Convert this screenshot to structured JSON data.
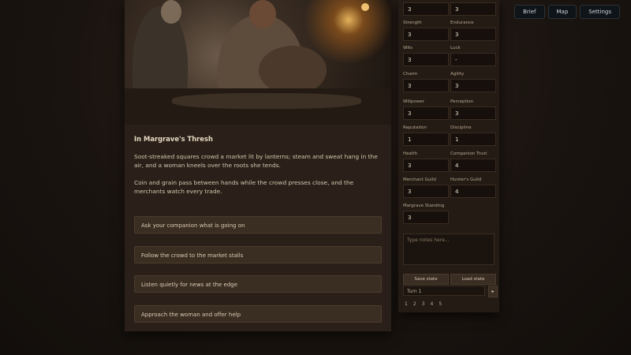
{
  "top_buttons": [
    "Brief",
    "Map",
    "Settings"
  ],
  "story": {
    "title": "In Margrave's Thresh",
    "paragraphs": [
      "Soot-streaked squares crowd a market lit by lanterns; steam and sweat hang in the air, and a woman kneels over the roots she tends.",
      "Coin and grain pass between hands while the crowd presses close, and the merchants watch every trade."
    ]
  },
  "choices": [
    "Ask your companion what is going on",
    "Follow the crowd to the market stalls",
    "Listen quietly for news at the edge",
    "Approach the woman and offer help"
  ],
  "stats": [
    {
      "label": "",
      "value": "3"
    },
    {
      "label": "",
      "value": "3"
    },
    {
      "label": "Strength",
      "value": "3"
    },
    {
      "label": "Endurance",
      "value": "3"
    },
    {
      "label": "Wits",
      "value": "3"
    },
    {
      "label": "Luck",
      "value": "-"
    },
    {
      "label": "Charm",
      "value": "3"
    },
    {
      "label": "Agility",
      "value": "3"
    },
    {
      "label": "Willpower",
      "value": "3"
    },
    {
      "label": "Perception",
      "value": "3"
    },
    {
      "label": "Reputation",
      "value": "1"
    },
    {
      "label": "Discipline",
      "value": "1"
    },
    {
      "label": "Health",
      "value": "3"
    },
    {
      "label": "Companion Trust",
      "value": "4"
    },
    {
      "label": "Merchant Guild",
      "value": "3"
    },
    {
      "label": "Hunter's Guild",
      "value": "4"
    },
    {
      "label": "Margrave Standing",
      "value": "3"
    }
  ],
  "notes_placeholder": "Type notes here...",
  "actions": {
    "left": "Save state",
    "right": "Load state"
  },
  "select_value": "Turn 1",
  "select_button": "▸",
  "pages": [
    "1",
    "2",
    "3",
    "4",
    "5"
  ]
}
